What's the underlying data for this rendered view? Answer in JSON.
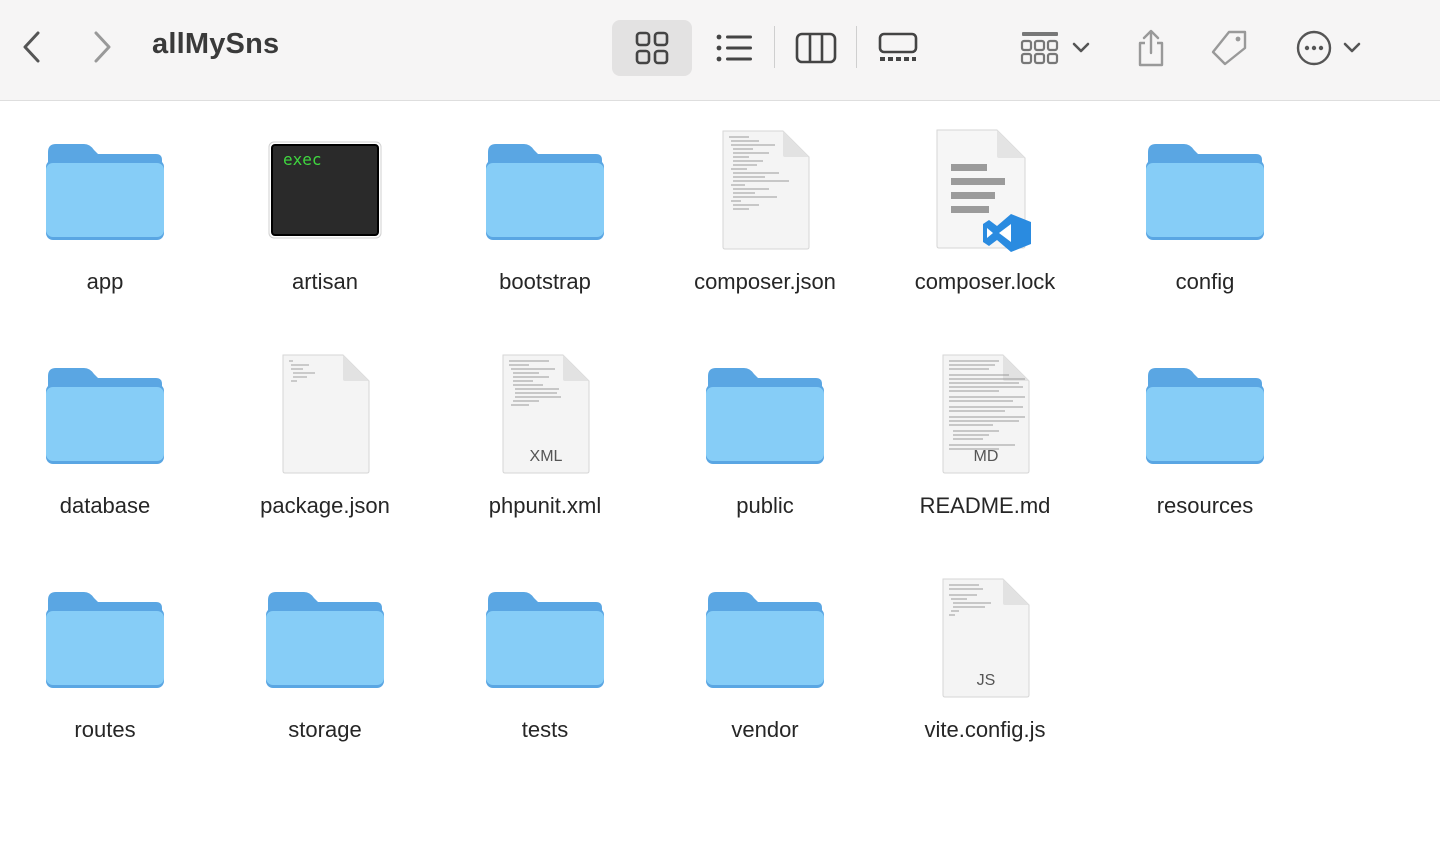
{
  "window": {
    "title": "allMySns"
  },
  "toolbar": {
    "back_icon": "chevron-left-icon",
    "forward_icon": "chevron-right-icon",
    "views": [
      "icon-view",
      "list-view",
      "column-view",
      "gallery-view"
    ],
    "selected_view": "icon-view",
    "group_icon": "group-grid-icon",
    "share_icon": "share-icon",
    "tag_icon": "tag-icon",
    "more_icon": "more-ellipsis-icon"
  },
  "colors": {
    "folder_body": "#86cdf7",
    "folder_tab": "#5aa6e3",
    "toolbar_bg": "#f6f5f5",
    "selected_view_bg": "#e3e2e2",
    "exec_green": "#3fd63f",
    "vscode_blue": "#2a8be0"
  },
  "files": [
    {
      "name": "app",
      "kind": "folder"
    },
    {
      "name": "artisan",
      "kind": "exec",
      "badge": "exec"
    },
    {
      "name": "bootstrap",
      "kind": "folder"
    },
    {
      "name": "composer.json",
      "kind": "doc"
    },
    {
      "name": "composer.lock",
      "kind": "vscode"
    },
    {
      "name": "config",
      "kind": "folder"
    },
    {
      "name": "database",
      "kind": "folder"
    },
    {
      "name": "package.json",
      "kind": "doc"
    },
    {
      "name": "phpunit.xml",
      "kind": "doc",
      "badge": "XML"
    },
    {
      "name": "public",
      "kind": "folder"
    },
    {
      "name": "README.md",
      "kind": "doc",
      "badge": "MD"
    },
    {
      "name": "resources",
      "kind": "folder"
    },
    {
      "name": "routes",
      "kind": "folder"
    },
    {
      "name": "storage",
      "kind": "folder"
    },
    {
      "name": "tests",
      "kind": "folder"
    },
    {
      "name": "vendor",
      "kind": "folder"
    },
    {
      "name": "vite.config.js",
      "kind": "doc",
      "badge": "JS"
    }
  ]
}
